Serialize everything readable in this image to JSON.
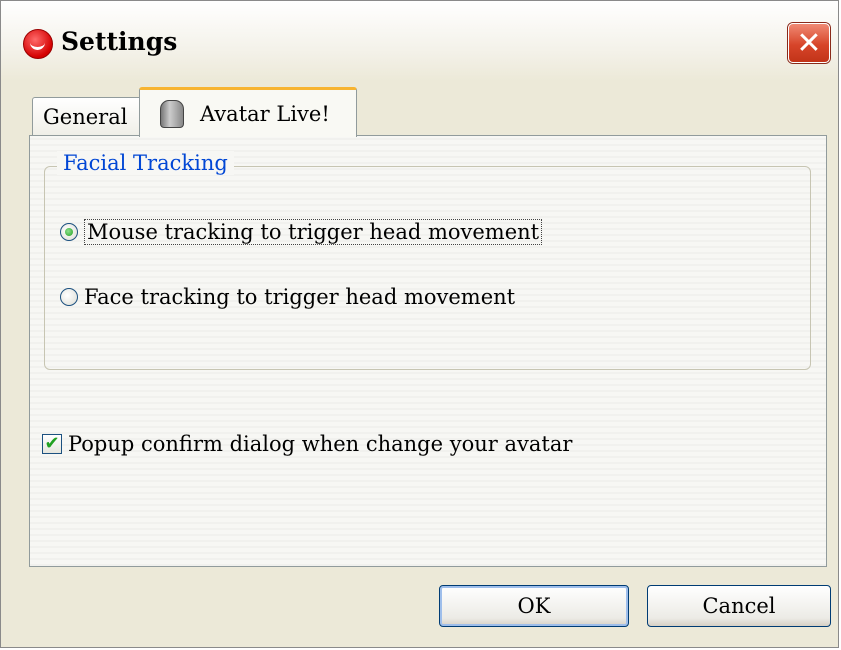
{
  "window": {
    "title": "Settings",
    "app_icon": "app-logo-icon",
    "close_glyph": "✕"
  },
  "tabs": [
    {
      "label": "General",
      "active": false
    },
    {
      "label": "Avatar Live!",
      "active": true,
      "icon": "avatar-icon"
    }
  ],
  "facial_tracking": {
    "legend": "Facial Tracking",
    "options": [
      {
        "label": "Mouse tracking to trigger head movement",
        "selected": true
      },
      {
        "label": "Face tracking to trigger head movement",
        "selected": false
      }
    ]
  },
  "popup_confirm": {
    "label": "Popup confirm dialog when change your avatar",
    "checked": true,
    "check_glyph": "✔"
  },
  "buttons": {
    "ok_label": "OK",
    "cancel_label": "Cancel"
  },
  "colors": {
    "legend": "#0046d5",
    "active_tab_accent": "#f7b431",
    "close_button": "#d7452a"
  }
}
